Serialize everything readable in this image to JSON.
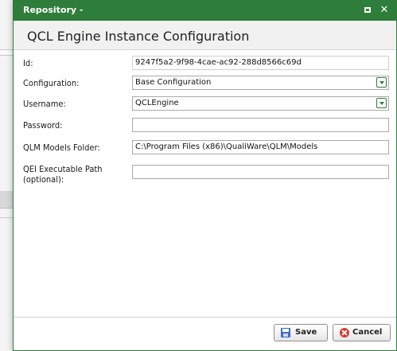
{
  "window": {
    "title": "Repository -"
  },
  "header": {
    "title": "QCL Engine Instance Configuration"
  },
  "form": {
    "id": {
      "label": "Id:",
      "value": "9247f5a2-9f98-4cae-ac92-288d8566c69d"
    },
    "configuration": {
      "label": "Configuration:",
      "value": "Base Configuration"
    },
    "username": {
      "label": "Username:",
      "value": "QCLEngine"
    },
    "password": {
      "label": "Password:",
      "value": ""
    },
    "models_folder": {
      "label": "QLM Models Folder:",
      "value": "C:\\Program Files (x86)\\QualiWare\\QLM\\Models"
    },
    "qei_path": {
      "label_line1": "QEI Executable Path",
      "label_line2": "(optional):",
      "value": ""
    }
  },
  "buttons": {
    "save": "Save",
    "cancel": "Cancel"
  },
  "icons": {
    "maximize": "maximize-icon",
    "close": "close-icon",
    "dropdown": "chevron-down-icon",
    "save": "floppy-disk-icon",
    "cancel": "cancel-icon"
  },
  "colors": {
    "titlebar": "#2e7d3a",
    "accent": "#2e7d3a",
    "cancel_icon": "#d63a2e",
    "save_icon": "#3a6ec8"
  }
}
